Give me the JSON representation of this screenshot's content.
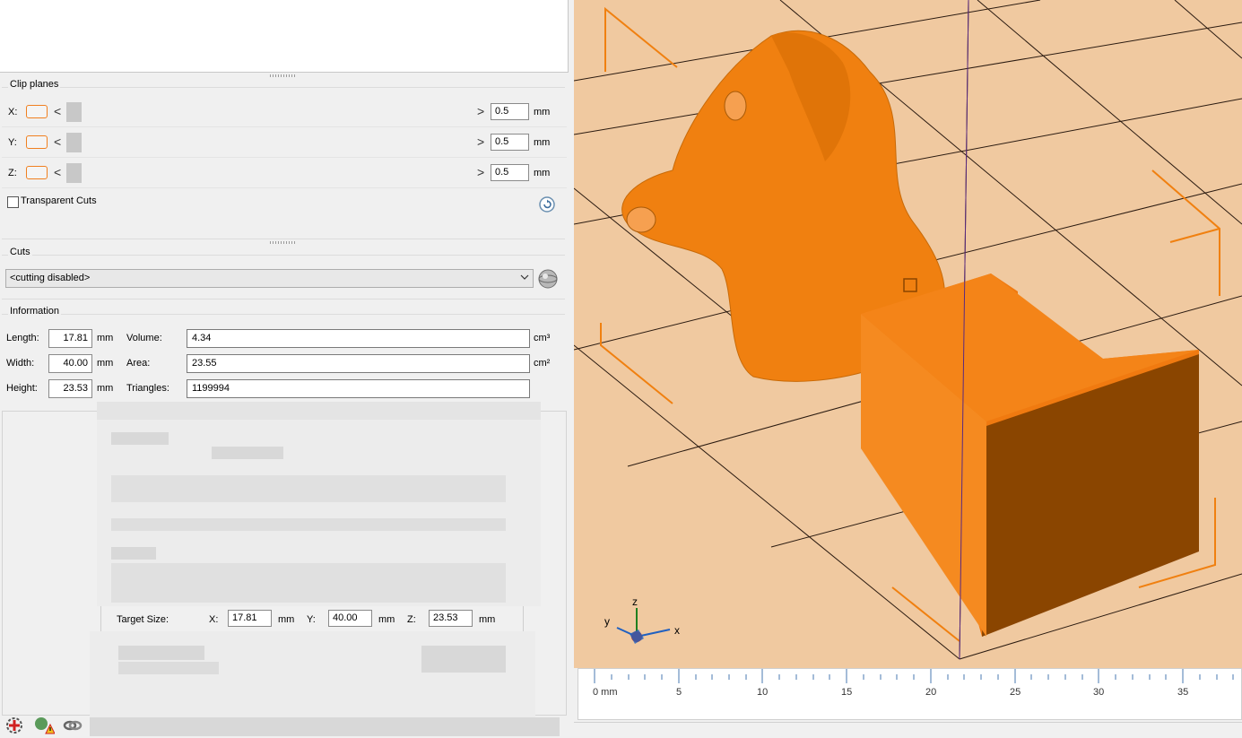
{
  "clip_planes": {
    "title": "Clip planes",
    "axes": [
      {
        "label": "X:",
        "value": "0.5",
        "unit": "mm"
      },
      {
        "label": "Y:",
        "value": "0.5",
        "unit": "mm"
      },
      {
        "label": "Z:",
        "value": "0.5",
        "unit": "mm"
      }
    ],
    "left_arrow": "<",
    "right_arrow": ">",
    "transparent_cuts_label": "Transparent Cuts",
    "transparent_cuts_checked": false,
    "reset_icon": "reset-icon"
  },
  "cuts": {
    "title": "Cuts",
    "selected": "<cutting disabled>"
  },
  "information": {
    "title": "Information",
    "length": {
      "label": "Length:",
      "value": "17.81",
      "unit": "mm"
    },
    "width": {
      "label": "Width:",
      "value": "40.00",
      "unit": "mm"
    },
    "height": {
      "label": "Height:",
      "value": "23.53",
      "unit": "mm"
    },
    "volume": {
      "label": "Volume:",
      "value": "4.34",
      "unit": "cm³"
    },
    "area": {
      "label": "Area:",
      "value": "23.55",
      "unit": "cm²"
    },
    "triangles": {
      "label": "Triangles:",
      "value": "1199994"
    }
  },
  "target_size": {
    "label": "Target Size:",
    "x": {
      "label": "X:",
      "value": "17.81",
      "unit": "mm"
    },
    "y": {
      "label": "Y:",
      "value": "40.00",
      "unit": "mm"
    },
    "z": {
      "label": "Z:",
      "value": "23.53",
      "unit": "mm"
    }
  },
  "ruler": {
    "labels": [
      "0 mm",
      "5",
      "10",
      "15",
      "20",
      "25",
      "30",
      "35"
    ]
  },
  "axis_indicator": {
    "x": "x",
    "y": "y",
    "z": "z"
  },
  "colors": {
    "model": "#f08010",
    "viewport_bg": "#f0c9a0",
    "bed_lines": "#2a1a10",
    "accent": "#f08020"
  }
}
